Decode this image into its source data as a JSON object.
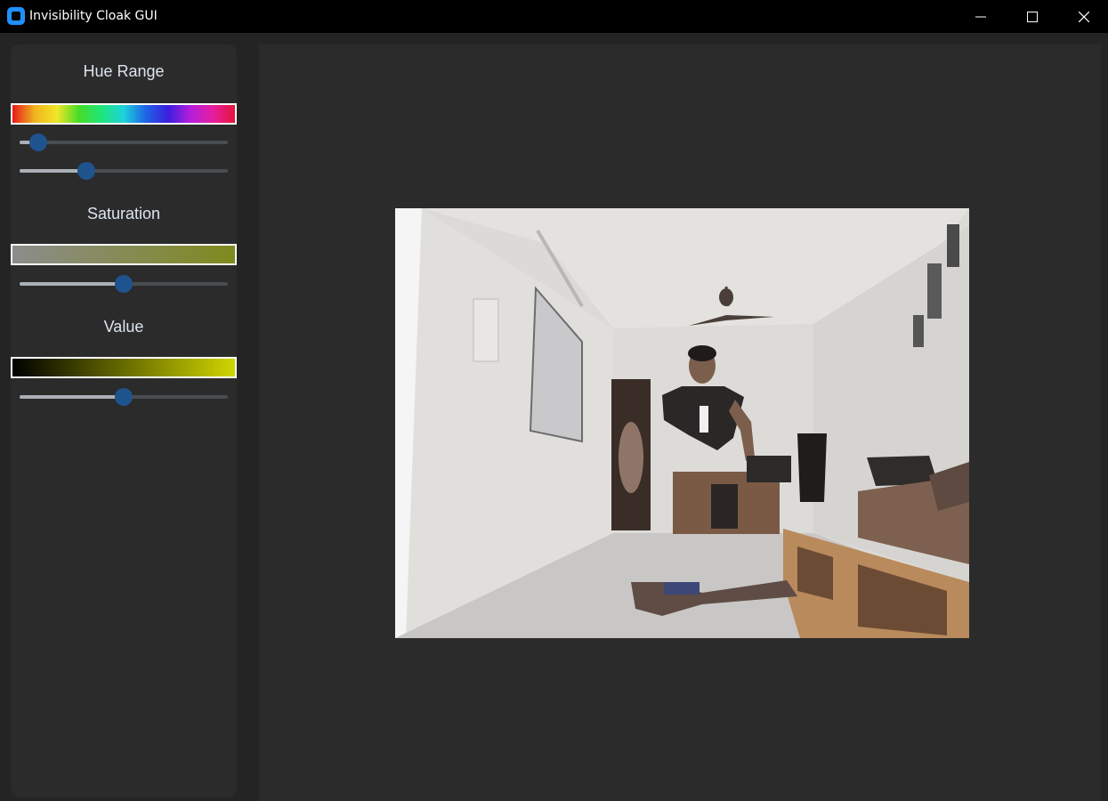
{
  "window": {
    "title": "Invisibility Cloak GUI"
  },
  "sections": {
    "hue": {
      "title": "Hue Range",
      "lower": 0.09,
      "upper": 0.32
    },
    "saturation": {
      "title": "Saturation",
      "value": 0.5
    },
    "value": {
      "title": "Value",
      "value": 0.5
    }
  },
  "colors": {
    "accent": "#1f538d",
    "sidebar_bg": "#2b2b2b",
    "app_bg": "#242424",
    "titlebar_bg": "#000000"
  },
  "icons": [
    "app-icon",
    "minimize-icon",
    "maximize-icon",
    "close-icon"
  ]
}
